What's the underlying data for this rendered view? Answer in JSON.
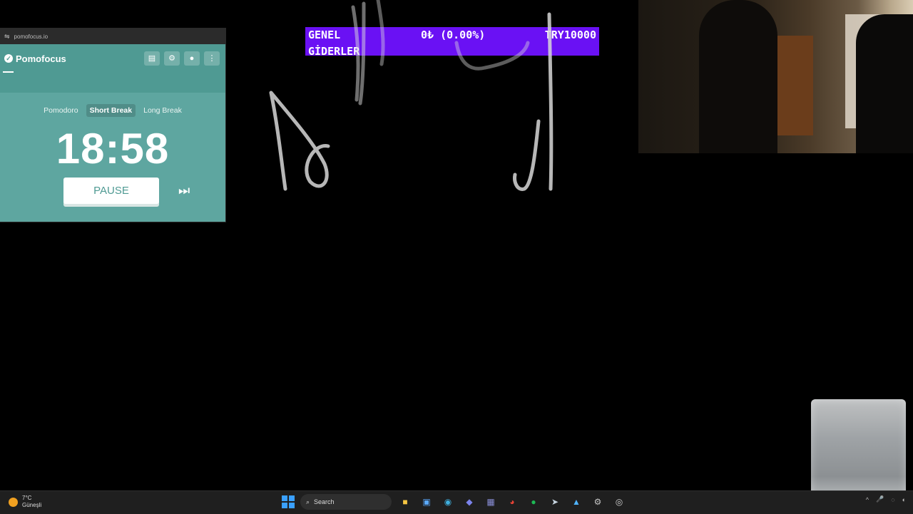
{
  "pomofocus": {
    "tab_url": "pomofocus.io",
    "app_name": "Pomofocus",
    "modes": [
      "Pomodoro",
      "Short Break",
      "Long Break"
    ],
    "active_mode": "Short Break",
    "timer": "18:58",
    "pause_label": "PAUSE"
  },
  "budget": {
    "category_line1": "GENEL",
    "category_line2": "GİDERLER",
    "spent": "0₺ (0.00%)",
    "limit": "TRY10000",
    "bg_color": "#6a11f4"
  },
  "taskbar": {
    "temperature": "7°C",
    "weather": "Güneşli",
    "search_placeholder": "Search"
  }
}
